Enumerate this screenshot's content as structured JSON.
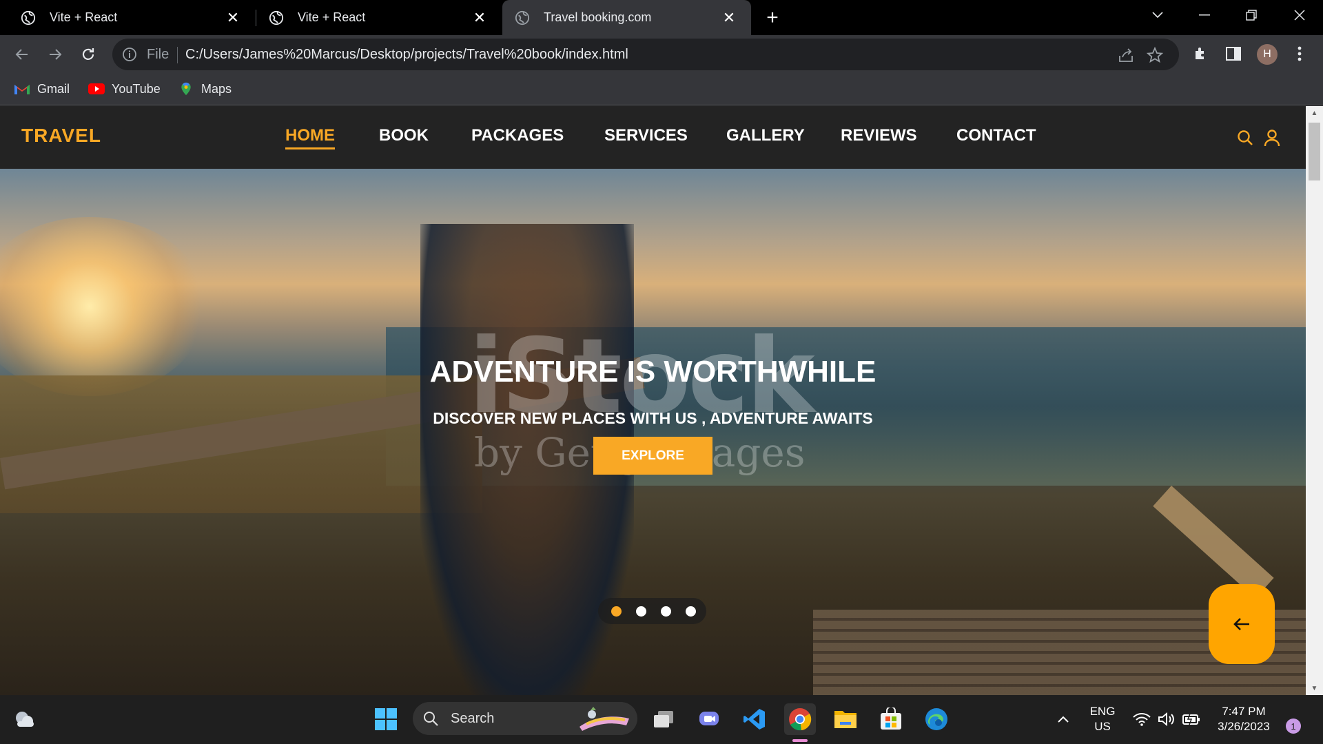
{
  "browser": {
    "tabs": [
      {
        "title": "Vite + React",
        "active": false
      },
      {
        "title": "Vite + React",
        "active": false
      },
      {
        "title": "Travel booking.com",
        "active": true
      }
    ],
    "address": {
      "scheme_label": "File",
      "url": "C:/Users/James%20Marcus/Desktop/projects/Travel%20book/index.html"
    },
    "profile_initial": "H",
    "bookmarks": [
      {
        "label": "Gmail",
        "icon": "gmail-icon"
      },
      {
        "label": "YouTube",
        "icon": "youtube-icon"
      },
      {
        "label": "Maps",
        "icon": "maps-icon"
      }
    ]
  },
  "site": {
    "logo": "TRAVEL",
    "nav": [
      "HOME",
      "BOOK",
      "PACKAGES",
      "SERVICES",
      "GALLERY",
      "REVIEWS",
      "CONTACT"
    ],
    "active_nav": "HOME",
    "hero": {
      "title": "ADVENTURE IS WORTHWHILE",
      "subtitle": "DISCOVER NEW PLACES WITH US , ADVENTURE AWAITS",
      "cta": "EXPLORE",
      "watermark": "iStock",
      "watermark_sub": "by Getty Images",
      "slides_total": 4,
      "active_slide": 1
    },
    "colors": {
      "accent": "#f9a825",
      "header_bg": "#232323"
    }
  },
  "taskbar": {
    "search_placeholder": "Search",
    "language_line1": "ENG",
    "language_line2": "US",
    "time": "7:47 PM",
    "date": "3/26/2023",
    "notifications": "1"
  }
}
